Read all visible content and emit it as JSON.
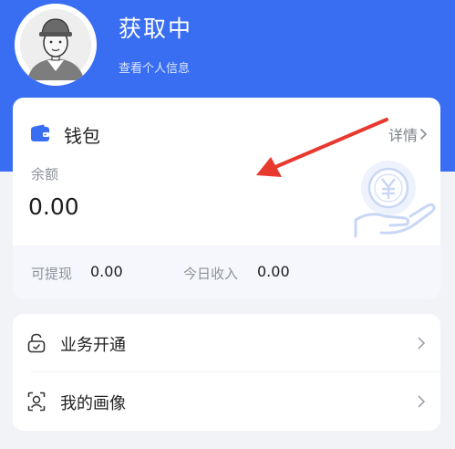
{
  "header": {
    "username": "获取中",
    "profile_link": "查看个人信息"
  },
  "wallet": {
    "title": "钱包",
    "details_label": "详情",
    "balance_label": "余额",
    "balance_value": "0.00",
    "withdrawable_label": "可提现",
    "withdrawable_value": "0.00",
    "today_income_label": "今日收入",
    "today_income_value": "0.00"
  },
  "menu": {
    "items": [
      {
        "label": "业务开通",
        "icon": "unlock-icon"
      },
      {
        "label": "我的画像",
        "icon": "portrait-icon"
      }
    ]
  },
  "colors": {
    "brand_blue": "#3a6ef2",
    "annotation_red": "#e8392f"
  }
}
